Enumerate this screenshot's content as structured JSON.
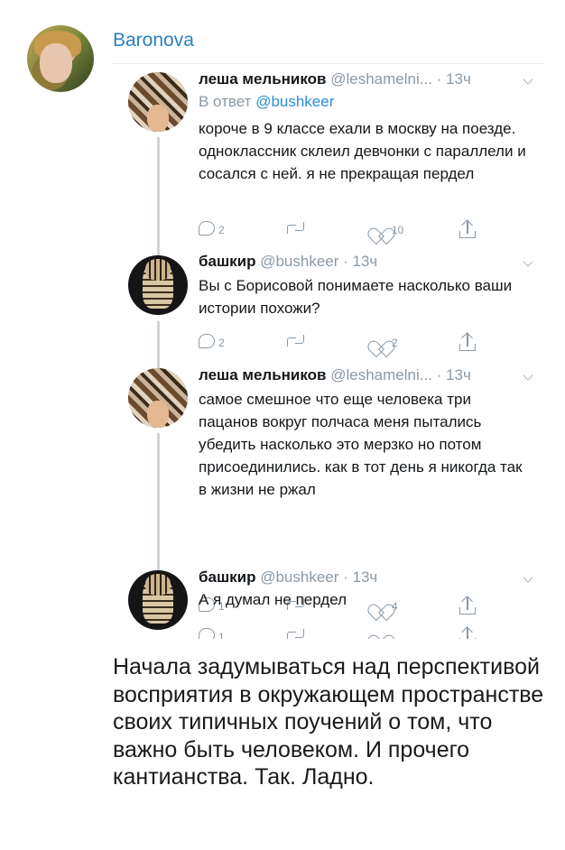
{
  "post": {
    "author": "Baronova",
    "caption": "Начала задумываться над перспективой восприятия в окружающем пространстве своих типичных поучений о том, что важно быть человеком. И прочего кантианства. Так. Ладно."
  },
  "tweets": [
    {
      "name": "леша мельников",
      "handle": "@leshamelni...",
      "time": "· 13ч",
      "reply_prefix": "В ответ",
      "reply_to": "@bushkeer",
      "text": "короче в 9 классе ехали в москву на поезде. одноклассник склеил девчонки с параллели и сосался с ней. я не прекращая пердел",
      "replies": "2",
      "retweets": "",
      "likes": "10"
    },
    {
      "name": "башкир",
      "handle": "@bushkeer",
      "time": "· 13ч",
      "text": "Вы с Борисовой понимаете насколько ваши истории похожи?",
      "replies": "2",
      "retweets": "",
      "likes": "2"
    },
    {
      "name": "леша мельников",
      "handle": "@leshamelni...",
      "time": "· 13ч",
      "text": "самое смешное что еще человека три пацанов вокруг полчаса меня пытались убедить насколько это мерзко но потом присоединились. как в тот день я никогда так в жизни не ржал",
      "replies": "1",
      "retweets": "",
      "likes": "4"
    },
    {
      "name": "башкир",
      "handle": "@bushkeer",
      "time": "· 13ч",
      "text": "А я думал не пердел",
      "replies": "1",
      "retweets": "",
      "likes": ""
    }
  ],
  "icons": {
    "reply": "reply-icon",
    "retweet": "retweet-icon",
    "like": "heart-icon",
    "share": "share-icon",
    "menu": "chevron-down-icon"
  },
  "colors": {
    "link": "#2a8fd8",
    "author_name": "#2a7fc1",
    "muted": "#8a99a6",
    "thread_line": "#ccd6dd"
  }
}
